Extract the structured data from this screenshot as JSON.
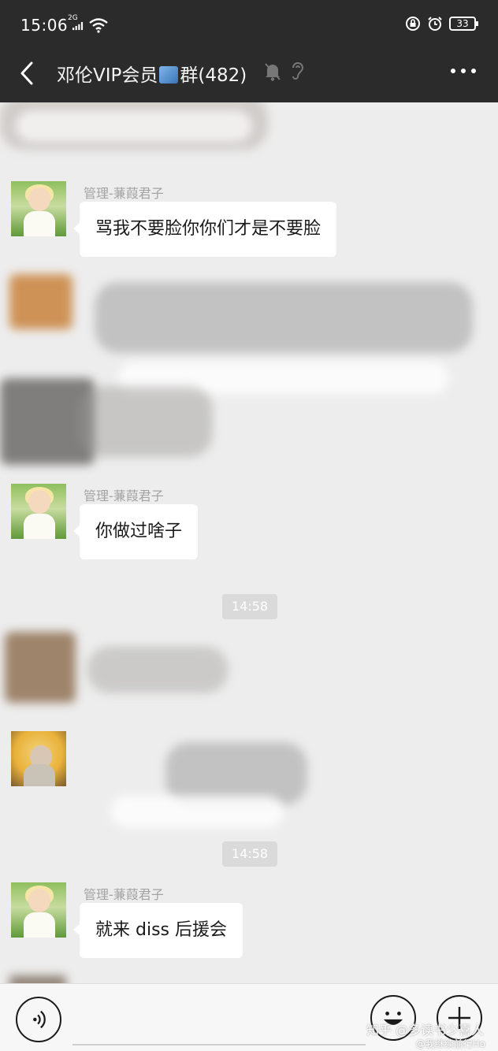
{
  "status_bar": {
    "time": "15:06",
    "network": "2G",
    "battery": "33"
  },
  "nav": {
    "title": "邓伦VIP会员",
    "title_suffix": "群(482)"
  },
  "messages": [
    {
      "nickname": "管理-蒹葭君子",
      "text": "骂我不要脸你你们才是不要脸"
    },
    {
      "nickname": "管理-蒹葭君子",
      "text": "你做过啥子"
    },
    {
      "nickname": "管理-蒹葭君子",
      "text": "就来 diss 后援会"
    }
  ],
  "timestamps": [
    "14:58",
    "14:58"
  ],
  "watermark": {
    "line1": "知乎 @多读书少喜人",
    "line2": "@我继续前行Ho"
  }
}
